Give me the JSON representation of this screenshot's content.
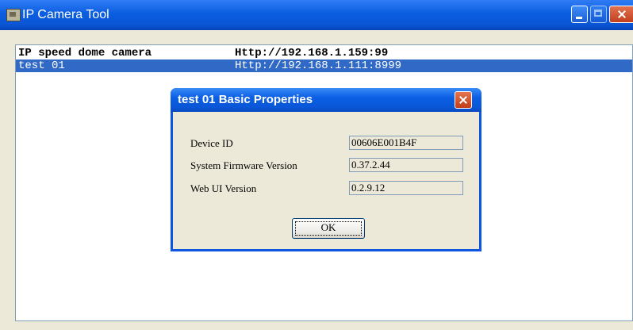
{
  "window": {
    "title": "IP Camera Tool",
    "icon": "camera-tool-icon"
  },
  "camera_list": {
    "rows": [
      {
        "name": "IP speed dome camera",
        "url": "Http://192.168.1.159:99",
        "selected": false
      },
      {
        "name": "test 01",
        "url": "Http://192.168.1.111:8999",
        "selected": true
      }
    ]
  },
  "dialog": {
    "title": "test 01 Basic Properties",
    "fields": [
      {
        "label": "Device ID",
        "value": "00606E001B4F"
      },
      {
        "label": "System Firmware Version",
        "value": "0.37.2.44"
      },
      {
        "label": "Web UI Version",
        "value": "0.2.9.12"
      }
    ],
    "ok_label": "OK"
  },
  "colors": {
    "titlebar": "#0b5de0",
    "selection": "#3169c6",
    "dialog_face": "#ece9d8"
  }
}
